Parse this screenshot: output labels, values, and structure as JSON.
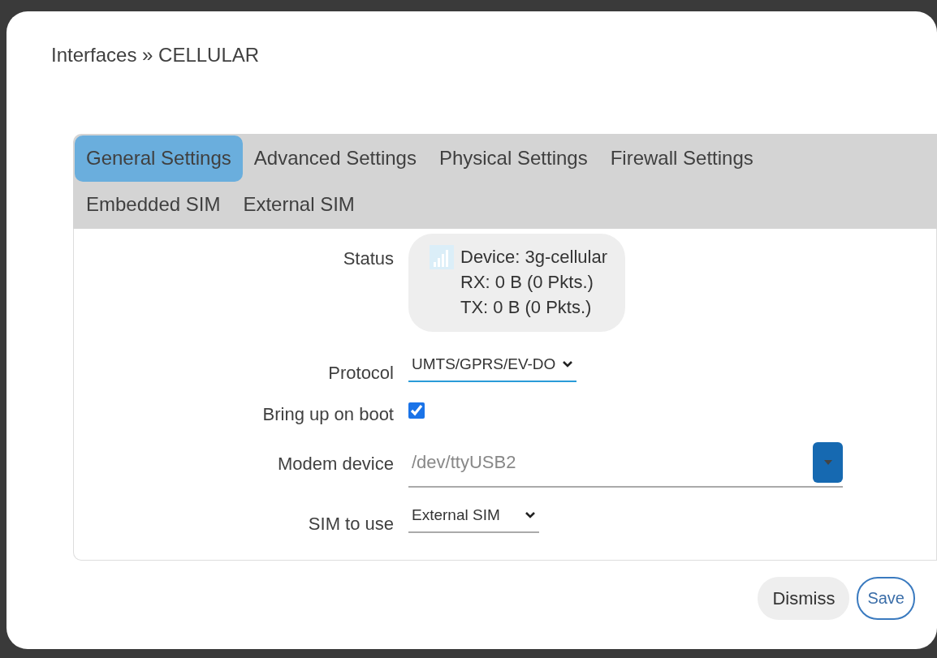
{
  "title": "Interfaces » CELLULAR",
  "tabs": [
    {
      "label": "General Settings",
      "selected": true
    },
    {
      "label": "Advanced Settings",
      "selected": false
    },
    {
      "label": "Physical Settings",
      "selected": false
    },
    {
      "label": "Firewall Settings",
      "selected": false
    },
    {
      "label": "Embedded SIM",
      "selected": false
    },
    {
      "label": "External SIM",
      "selected": false
    }
  ],
  "fields": [
    {
      "kind": "status",
      "label": "Status",
      "lines": [
        "Device: 3g-cellular",
        "RX: 0 B (0 Pkts.)",
        "TX: 0 B (0 Pkts.)"
      ]
    },
    {
      "kind": "select",
      "label": "Protocol",
      "value": "UMTS/GPRS/EV-DO",
      "focused": true
    },
    {
      "kind": "checkbox",
      "label": "Bring up on boot",
      "checked": true
    },
    {
      "kind": "combo",
      "label": "Modem device",
      "placeholder": "/dev/ttyUSB2"
    },
    {
      "kind": "select",
      "label": "SIM to use",
      "value": "External SIM",
      "focused": false
    }
  ],
  "buttons": [
    {
      "label": "Dismiss",
      "kind": "secondary"
    },
    {
      "label": "Save",
      "kind": "primary"
    }
  ]
}
